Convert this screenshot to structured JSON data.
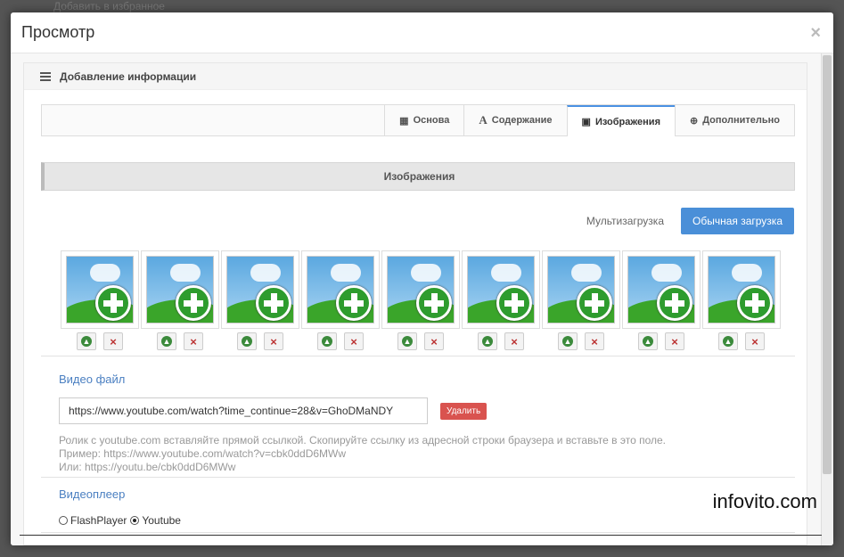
{
  "backdrop": {
    "text": "Добавить в избранное"
  },
  "modal": {
    "title": "Просмотр",
    "close": "×"
  },
  "panel": {
    "heading": "Добавление информации"
  },
  "tabs": [
    {
      "label": "Основа",
      "icon": "table-icon",
      "active": false
    },
    {
      "label": "Содержание",
      "icon": "font-icon",
      "active": false
    },
    {
      "label": "Изображения",
      "icon": "picture-icon",
      "active": true
    },
    {
      "label": "Дополнительно",
      "icon": "plus-circle-icon",
      "active": false
    }
  ],
  "images_section": {
    "title": "Изображения",
    "multi_upload": "Мультизагрузка",
    "normal_upload": "Обычная загрузка",
    "slot_count": 9
  },
  "video": {
    "label": "Видео файл",
    "value": "https://www.youtube.com/watch?time_continue=28&v=GhoDMaNDY",
    "delete": "Удалить",
    "help_line1": "Ролик с youtube.com вставляйте прямой ссылкой. Скопируйте ссылку из адресной строки браузера и вставьте в это поле.",
    "help_line2": "Пример: https://www.youtube.com/watch?v=cbk0ddD6MWw",
    "help_line3": "Или: https://youtu.be/cbk0ddD6MWw"
  },
  "player": {
    "label": "Видеоплеер",
    "options": [
      {
        "label": "FlashPlayer",
        "selected": false
      },
      {
        "label": "Youtube",
        "selected": true
      }
    ]
  },
  "watermark": "infovito.com",
  "colors": {
    "accent": "#4a8fd8",
    "danger": "#d9534f",
    "label_blue": "#4a7fc1"
  }
}
